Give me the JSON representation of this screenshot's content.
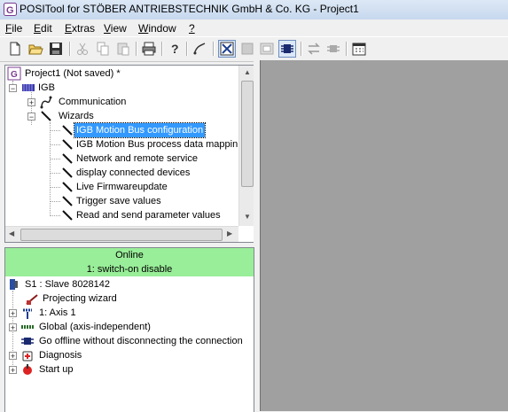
{
  "window": {
    "title": "POSITool for STÖBER ANTRIEBSTECHNIK GmbH & Co. KG - Project1"
  },
  "menu": [
    {
      "label": "File"
    },
    {
      "label": "Edit"
    },
    {
      "label": "Extras"
    },
    {
      "label": "View"
    },
    {
      "label": "Window"
    },
    {
      "label": "?"
    }
  ],
  "toolbar": {
    "buttons": [
      "new-icon",
      "open-icon",
      "save-icon",
      "cut-icon",
      "copy-icon",
      "paste-icon",
      "print-icon",
      "help-icon",
      "wizard-icon",
      "online-icon",
      "window1-icon",
      "window2-icon",
      "connect-icon",
      "transfer-icon",
      "disconnect-icon",
      "calendar-icon"
    ]
  },
  "project_tree": {
    "root": "Project1 (Not saved) *",
    "igb": "IGB",
    "communication": "Communication",
    "wizards": "Wizards",
    "wizard_items": [
      "IGB Motion Bus configuration",
      "IGB Motion Bus process data mapping",
      "Network and remote service",
      "display connected devices",
      "Live Firmwareupdate",
      "Trigger save values",
      "Read and send parameter values"
    ]
  },
  "status": {
    "line1": "Online",
    "line2": "1: switch-on disable",
    "color": "#99ee99"
  },
  "device_tree": {
    "slave": "S1 : Slave 8028142",
    "items": [
      "Projecting wizard",
      "1: Axis 1",
      "Global (axis-independent)",
      "Go offline without disconnecting the connection",
      "Diagnosis",
      "Start up"
    ]
  },
  "colors": {
    "selection": "#3399ff",
    "mdi_background": "#a0a0a0"
  }
}
